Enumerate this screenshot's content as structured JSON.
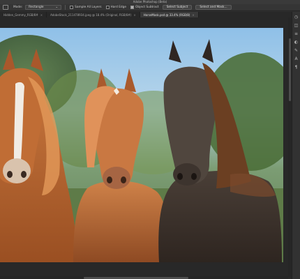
{
  "app": {
    "title": "Adobe Photoshop (Beta)"
  },
  "options_bar": {
    "mode_label": "Mode:",
    "mode_value": "Rectangle",
    "sample_all_layers": "Sample All Layers",
    "hard_edge": "Hard Edge",
    "object_subtract": "Object Subtract",
    "select_subject": "Select Subject",
    "select_and_mask": "Select and Mask..."
  },
  "tabs": [
    {
      "label": "Hidden_Gemmy_RGB/8#",
      "active": false
    },
    {
      "label": "AdobeStock_211478934.jpeg @ 18.4% (Original, RGB/8#)",
      "active": false
    },
    {
      "label": "HorseMask.psd @ 33.4% (RGB/8)",
      "active": true
    }
  ],
  "right_panel": {
    "icons": [
      "history-icon",
      "layers-icon",
      "properties-icon",
      "adjustments-icon",
      "brush-icon",
      "char-icon",
      "paragraph-icon"
    ]
  }
}
